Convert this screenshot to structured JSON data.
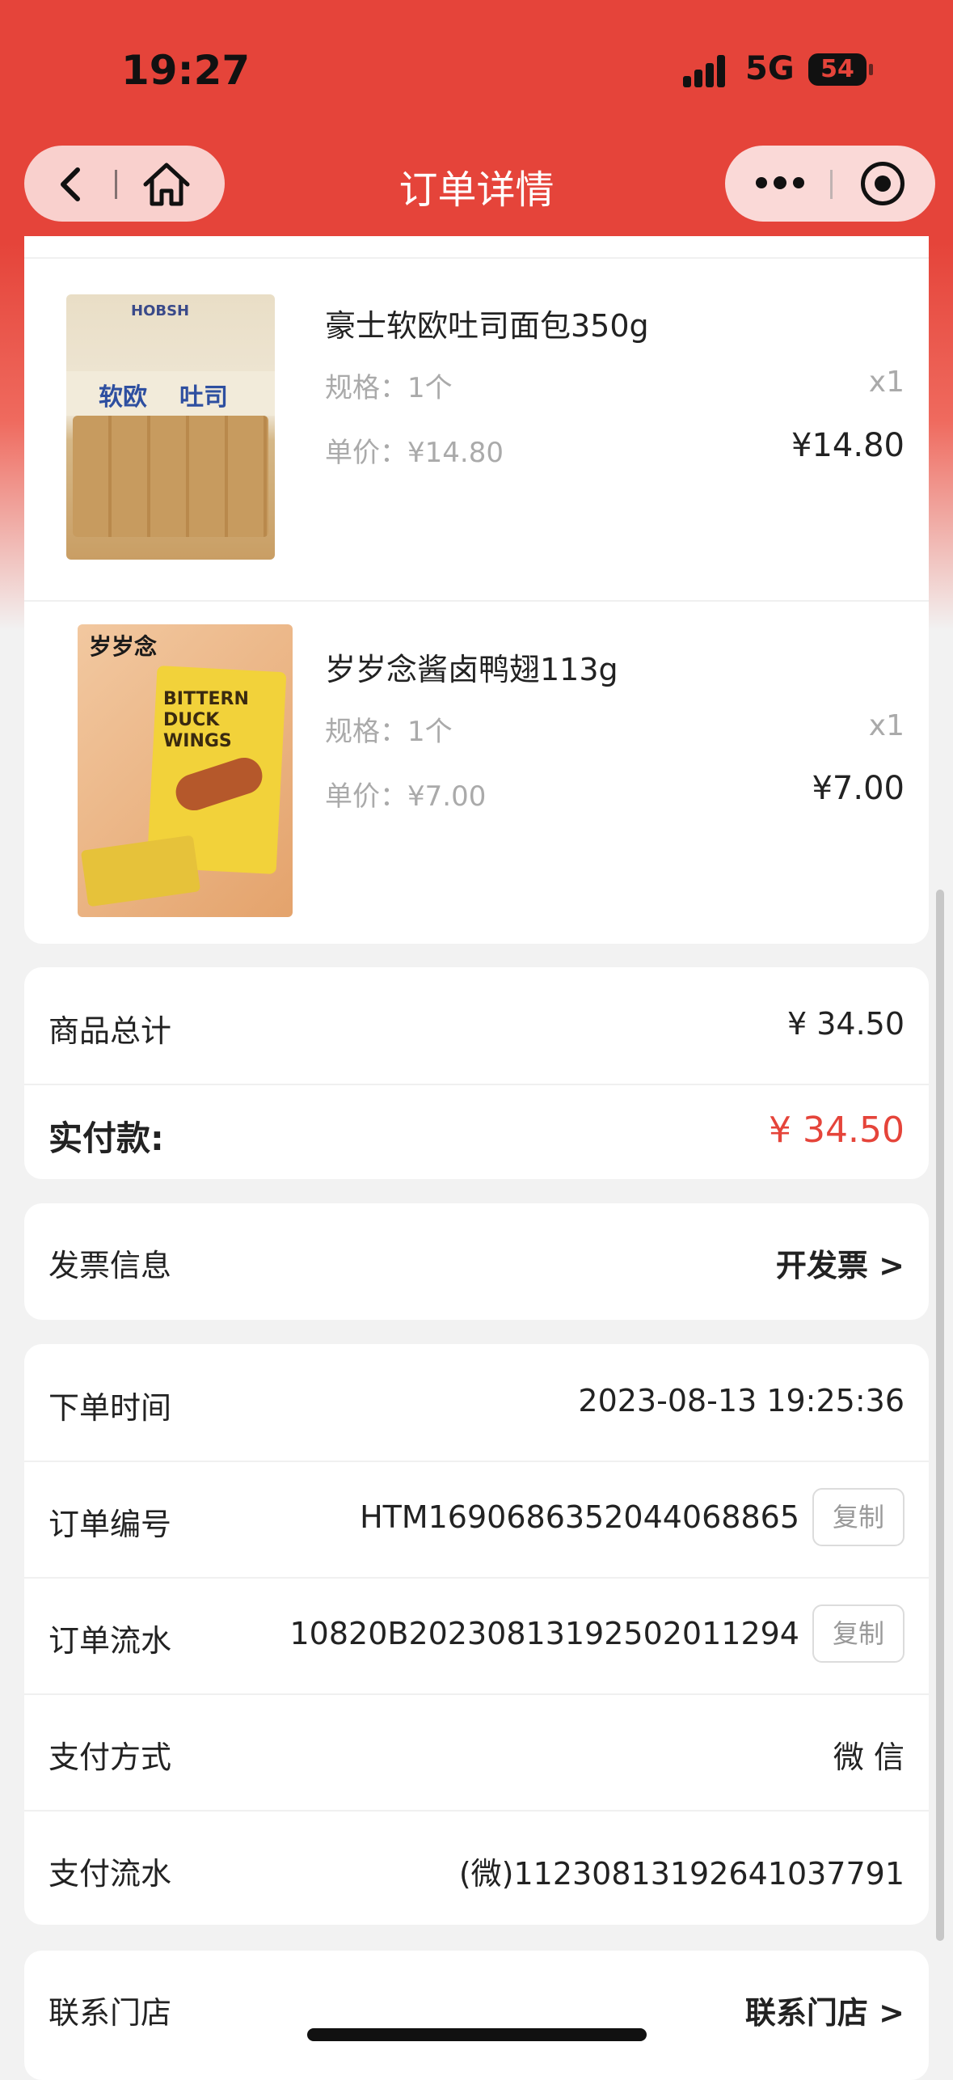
{
  "status_bar": {
    "time": "19:27",
    "network": "5G",
    "battery": "54"
  },
  "nav": {
    "title": "订单详情"
  },
  "products": [
    {
      "name": "豪士软欧吐司面包350g",
      "spec": "规格：1个",
      "qty": "x1",
      "unit_price": "单价：¥14.80",
      "price": "¥14.80",
      "image_text": {
        "brand": "HOBSH",
        "line1": "软欧",
        "line2": "吐司"
      }
    },
    {
      "name": "岁岁念酱卤鸭翅113g",
      "spec": "规格：1个",
      "qty": "x1",
      "unit_price": "单价：¥7.00",
      "price": "¥7.00",
      "image_text": {
        "brand": "岁岁念",
        "line1": "BITTERN DUCK WINGS"
      }
    }
  ],
  "totals": {
    "subtotal_label": "商品总计",
    "subtotal_value": "¥ 34.50",
    "paid_label": "实付款:",
    "paid_value": "¥ 34.50"
  },
  "invoice": {
    "label": "发票信息",
    "action": "开发票 >"
  },
  "order_info": {
    "time_label": "下单时间",
    "time_value": "2023-08-13 19:25:36",
    "number_label": "订单编号",
    "number_value": "HTM1690686352044068865",
    "flow_label": "订单流水",
    "flow_value": "10820B20230813192502011294",
    "pay_method_label": "支付方式",
    "pay_method_value": "微 信",
    "pay_flow_label": "支付流水",
    "pay_flow_value": "(微)11230813192641037791",
    "copy_label": "复制"
  },
  "store": {
    "label": "联系门店",
    "action": "联系门店 >"
  },
  "colors": {
    "primary_red": "#e5443a"
  }
}
